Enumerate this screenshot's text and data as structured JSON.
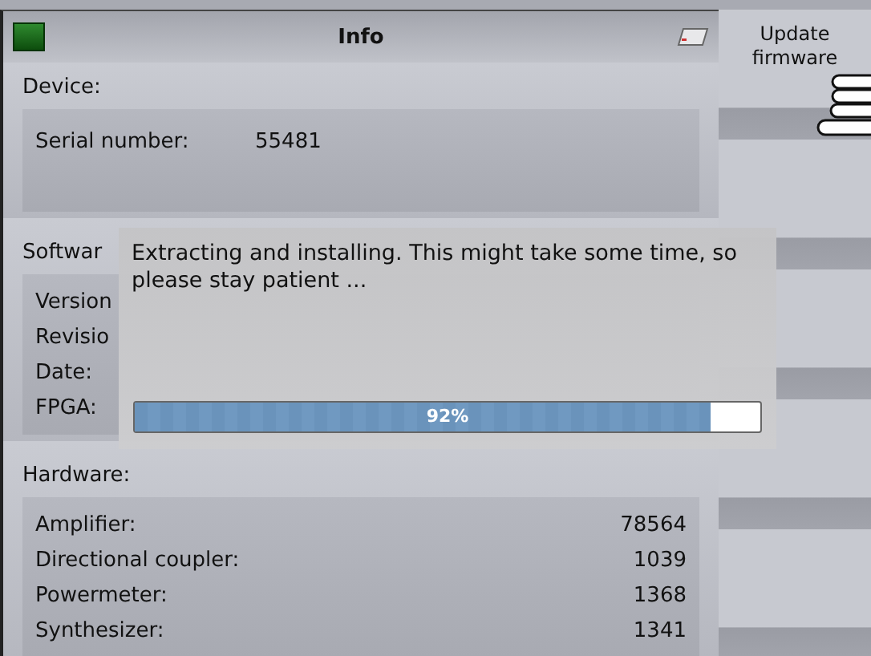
{
  "window": {
    "title": "Info"
  },
  "device": {
    "header": "Device:",
    "rows": [
      {
        "label": "Serial number:",
        "value": "55481"
      }
    ]
  },
  "software": {
    "header": "Softwar",
    "rows": [
      {
        "label": "Version"
      },
      {
        "label": "Revisio"
      },
      {
        "label": "Date:"
      },
      {
        "label": "FPGA:"
      }
    ]
  },
  "hardware": {
    "header": "Hardware:",
    "rows": [
      {
        "label": "Amplifier:",
        "value": "78564"
      },
      {
        "label": "Directional coupler:",
        "value": "1039"
      },
      {
        "label": "Powermeter:",
        "value": "1368"
      },
      {
        "label": "Synthesizer:",
        "value": "1341"
      }
    ]
  },
  "soft_keys": [
    {
      "label": "Update firmware"
    }
  ],
  "dialog": {
    "message": "Extracting and installing. This might take some time, so please stay patient  ...",
    "progress": {
      "level": 0.92,
      "reading": "92%"
    }
  }
}
